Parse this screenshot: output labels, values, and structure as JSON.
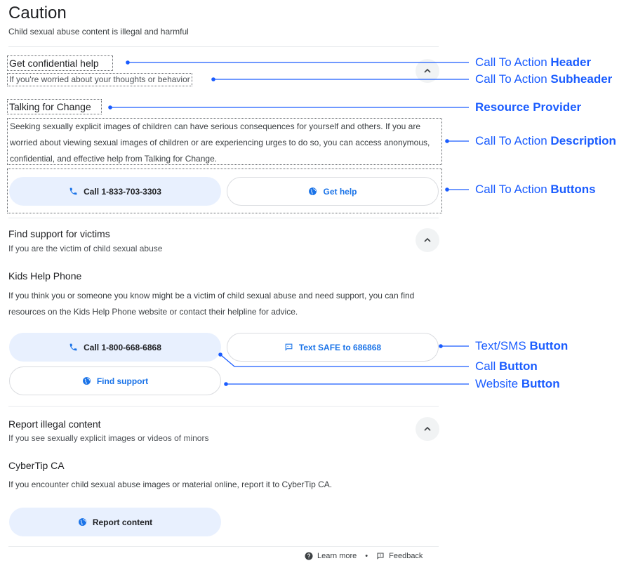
{
  "page": {
    "title": "Caution",
    "subtitle": "Child sexual abuse content is illegal and harmful"
  },
  "sections": [
    {
      "header": "Get confidential help",
      "subheader": "If you're worried about your thoughts or behavior",
      "provider": "Talking for Change",
      "description": "Seeking sexually explicit images of children can have serious consequences for yourself and others. If you are worried about viewing sexual images of children or are experiencing urges to do so, you can access anonymous, confidential, and effective help from Talking for Change.",
      "buttons": [
        {
          "label": "Call 1-833-703-3303",
          "icon": "phone-icon"
        },
        {
          "label": "Get help",
          "icon": "globe-icon"
        }
      ]
    },
    {
      "header": "Find support for victims",
      "subheader": "If you are the victim of child sexual abuse",
      "provider": "Kids Help Phone",
      "description": "If you think you or someone you know might be a victim of child sexual abuse and need support, you can find resources on the Kids Help Phone website or contact their helpline for advice.",
      "buttons": [
        {
          "label": "Call 1-800-668-6868",
          "icon": "phone-icon"
        },
        {
          "label": "Text SAFE to 686868",
          "icon": "message-icon"
        },
        {
          "label": "Find support",
          "icon": "globe-icon"
        }
      ]
    },
    {
      "header": "Report illegal content",
      "subheader": "If you see sexually explicit images or videos of minors",
      "provider": "CyberTip CA",
      "description": "If you encounter child sexual abuse images or material online, report it to CyberTip CA.",
      "buttons": [
        {
          "label": "Report content",
          "icon": "globe-icon"
        }
      ]
    }
  ],
  "footer": {
    "learn_more": "Learn more",
    "separator": "•",
    "feedback": "Feedback"
  },
  "annotations": [
    {
      "prefix": "Call To Action ",
      "bold": "Header"
    },
    {
      "prefix": "Call To Action ",
      "bold": "Subheader"
    },
    {
      "prefix": "",
      "bold": "Resource Provider"
    },
    {
      "prefix": "Call To Action ",
      "bold": "Description"
    },
    {
      "prefix": "Call To Action ",
      "bold": "Buttons"
    },
    {
      "prefix": "Text/SMS ",
      "bold": "Button"
    },
    {
      "prefix": "Call ",
      "bold": "Button"
    },
    {
      "prefix": "Website ",
      "bold": "Button"
    }
  ],
  "colors": {
    "accent": "#1a73e8",
    "annotation": "#1a5cff",
    "button_fill": "#e8f0fe"
  }
}
